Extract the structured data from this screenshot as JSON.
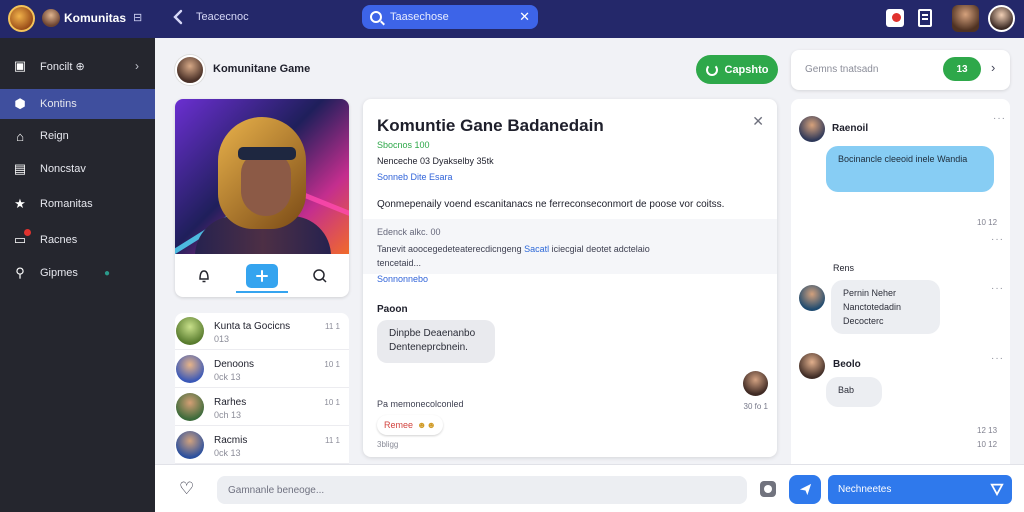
{
  "topbar": {
    "title": "Komunitas",
    "mini_icon_text": "⊟",
    "tab_title": "Teacecnoc",
    "search": {
      "value": "",
      "placeholder": "Taasechose"
    },
    "icons": [
      "search-icon",
      "close-icon",
      "record-icon",
      "document-icon",
      "back-icon"
    ]
  },
  "sidebar": {
    "items": [
      {
        "label": "Foncilt ⊕",
        "icon": "bookmark-icon"
      },
      {
        "label": "Kontins",
        "icon": "hexagon-icon"
      },
      {
        "label": "Reign",
        "icon": "home-icon"
      },
      {
        "label": "Noncstav",
        "icon": "document-icon"
      },
      {
        "label": "Romanitas",
        "icon": "star-icon"
      },
      {
        "label": "Racnes",
        "icon": "notification-icon"
      },
      {
        "label": "Gipmes",
        "icon": "search-icon"
      }
    ]
  },
  "main": {
    "header_title": "Komunitane Game",
    "invite_label": "Capshto"
  },
  "game_card": {
    "actions": [
      "bell-icon",
      "add-icon",
      "search-icon"
    ]
  },
  "members": [
    {
      "name": "Kunta ta Gocicns",
      "sub": "013",
      "time": "11 1"
    },
    {
      "name": "Denoons",
      "sub": "0ck 13",
      "time": "10 1"
    },
    {
      "name": "Rarhes",
      "sub": "0ch 13",
      "time": "10 1"
    },
    {
      "name": "Racmis",
      "sub": "0ck 13",
      "time": "11 1"
    }
  ],
  "detail": {
    "title": "Komuntie Gane Badanedain",
    "status": "Sbocnos  100",
    "stat": "Nenceche 03 Dyakselby 35tk",
    "link": "Sonneb Dite Esara",
    "description": "Qonmepenaily voend escanitanacs ne ferreconseconmort de poose vor coitss.",
    "sub_1": "Edenck alkc. 00",
    "sub_2_a": "Tanevit aoocegedeteaterecdicngeng",
    "sub_2_hl": "Sacatl",
    "sub_2_b": "iciecgial deotet adctelaio",
    "sub_3": "tencetaid...",
    "sub_link": "Sonnonnebo",
    "comment_author": "Paoon",
    "comment_text": "Dinpbe Deaenanbo Denteneprcbnein.",
    "comment_time": "30 fo 1",
    "reply_label": "Pa memonecolconled",
    "reaction_label": "Remee",
    "reaction_count": "3bligg"
  },
  "right_col": {
    "search_placeholder": "Gemns tnatsadn",
    "go_label": "13",
    "messages": [
      {
        "name": "Raenoil",
        "text": "Bocinancle cleeoid  inele Wandia",
        "time": "10 12"
      },
      {
        "label": "Rens",
        "name": "",
        "text": "Pernin  Neher Nanctotedadin  Decocterc",
        "time": "10 12"
      },
      {
        "name": "Beolo",
        "text": "Bab",
        "time": "12 13"
      }
    ]
  },
  "composer": {
    "placeholder": "Gamnanle beneoge...",
    "send_label": "Nechneetes"
  },
  "colors": {
    "topbar": "#24286a",
    "sidebar": "#25262e",
    "accent_blue": "#2f79ec",
    "accent_green": "#2ea84a"
  }
}
